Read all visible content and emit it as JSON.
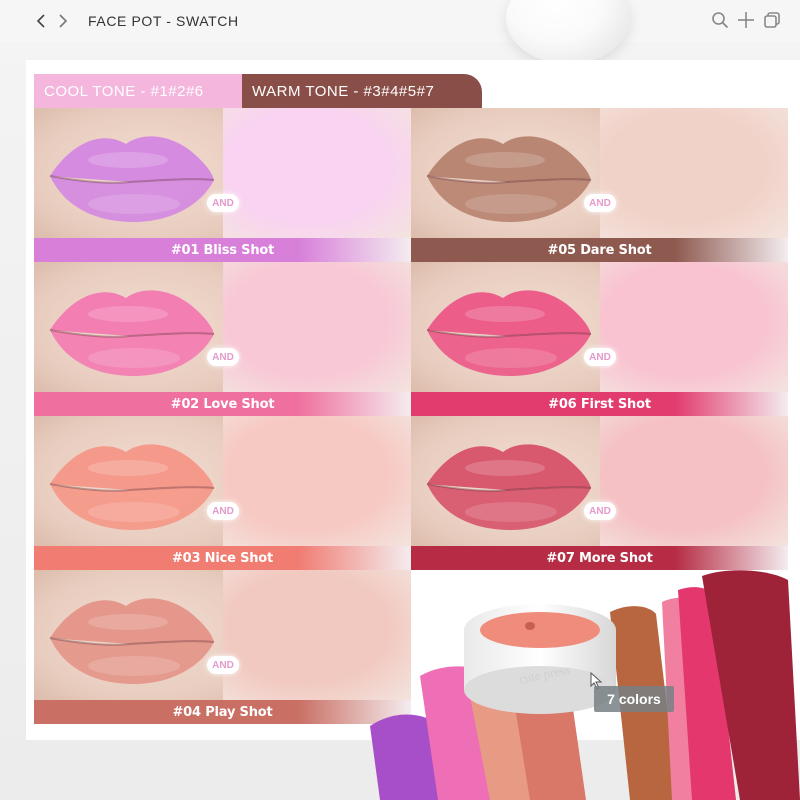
{
  "toolbar": {
    "title": "FACE POT - SWATCH",
    "back_icon": "chevron-left-icon",
    "forward_icon": "chevron-right-icon",
    "actions": [
      "search-icon",
      "plus-icon",
      "copy-icon"
    ]
  },
  "tabs": [
    {
      "label": "COOL TONE - #1#2#6",
      "color": "#f5b6de"
    },
    {
      "label": "WARM TONE - #3#4#5#7",
      "color": "#8a4e48"
    }
  ],
  "and_label": "AND",
  "shades": [
    {
      "label": "#01 Bliss Shot",
      "lip": "#d58be0",
      "blush": "#f9d3f1",
      "bar": "#d77fd9"
    },
    {
      "label": "#05 Dare Shot",
      "lip": "#b98673",
      "blush": "#f1d2c8",
      "bar": "#8e5a4f"
    },
    {
      "label": "#02 Love Shot",
      "lip": "#f37eb1",
      "blush": "#f8c8d6",
      "bar": "#ef6f9e"
    },
    {
      "label": "#06 First Shot",
      "lip": "#ec5d8a",
      "blush": "#f9c3d1",
      "bar": "#e23b6e"
    },
    {
      "label": "#03 Nice Shot",
      "lip": "#f59a8a",
      "blush": "#f7c9c3",
      "bar": "#f07c72"
    },
    {
      "label": "#07 More Shot",
      "lip": "#d8586e",
      "blush": "#f5c1c4",
      "bar": "#b52c44"
    },
    {
      "label": "#04 Play Shot",
      "lip": "#e4978a",
      "blush": "#f1c9c0",
      "bar": "#c96f63"
    }
  ],
  "product": {
    "tooltip": "7 colors"
  }
}
